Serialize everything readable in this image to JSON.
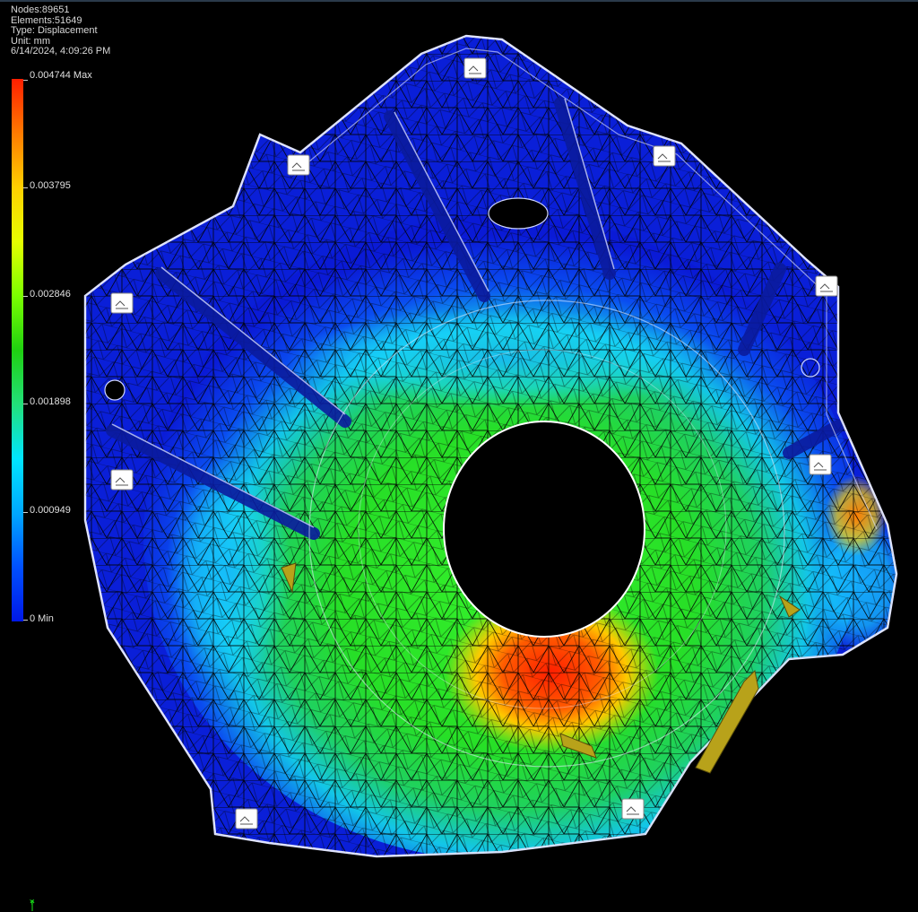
{
  "info": {
    "nodes": "Nodes:89651",
    "elements": "Elements:51649",
    "type": "Type: Displacement",
    "unit": "Unit: mm",
    "timestamp": "6/14/2024, 4:09:26 PM"
  },
  "legend": {
    "ticks": [
      "0.004744 Max",
      "0.003795",
      "0.002846",
      "0.001898",
      "0.000949",
      "0 Min"
    ],
    "colors": [
      "#ff1e00",
      "#ffd000",
      "#7bff00",
      "#1fd010",
      "#00e5ff",
      "#0018e8"
    ]
  },
  "triad": {
    "axis_label": "Y"
  },
  "colors": {
    "background": "#000000",
    "mesh_base": "#0a1fd8",
    "high_stress": "#ff2a00",
    "mid_stress": "#29e52a",
    "low_stress": "#1ee6ff",
    "constraint_marker": "#ffffff",
    "load_arrow": "#b8a21a"
  }
}
